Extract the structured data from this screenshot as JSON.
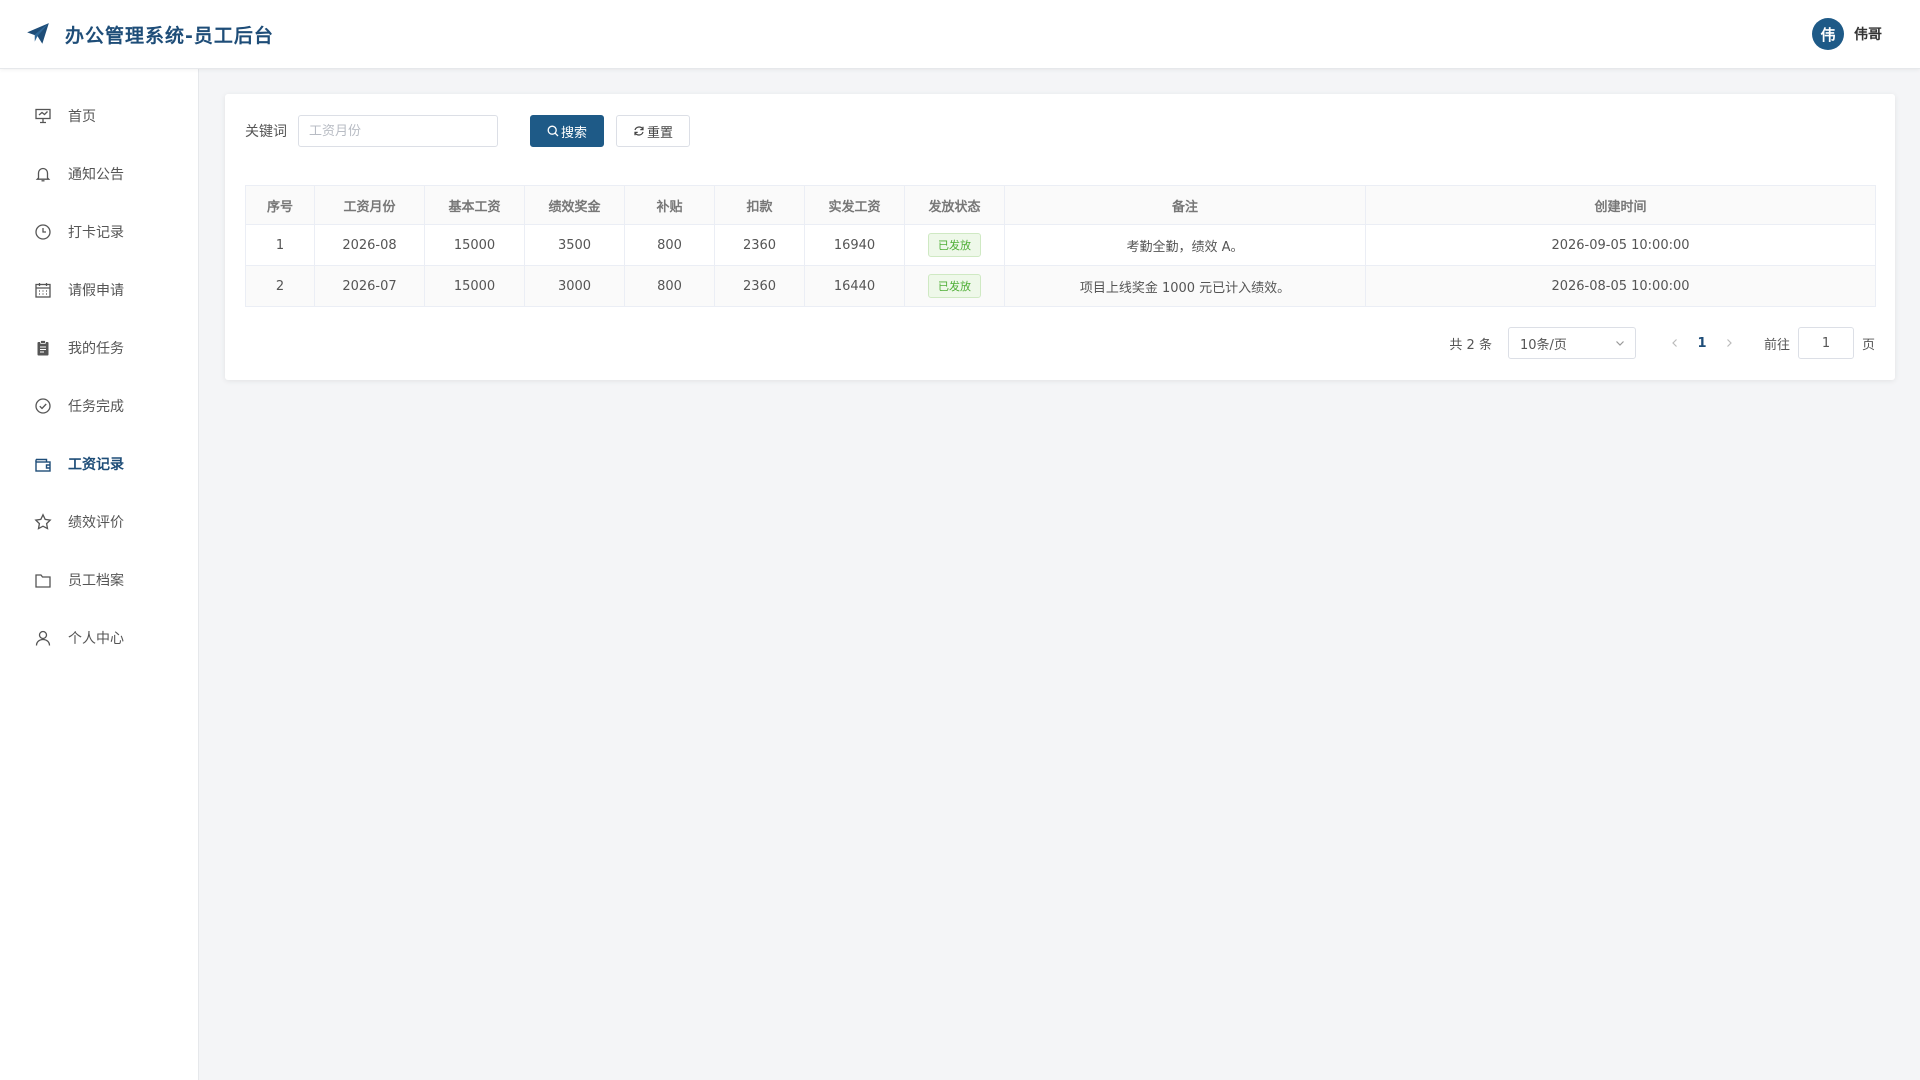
{
  "header": {
    "title": "办公管理系统-员工后台",
    "logo_icon": "paper-plane-icon",
    "user": {
      "avatar_text": "伟",
      "name": "伟哥"
    }
  },
  "colors": {
    "brand": "#1e4d78",
    "primary_button": "#1e5a87",
    "success_text": "#4fae36",
    "background": "#f4f5f7"
  },
  "sidebar": {
    "active": "工资记录",
    "items": [
      {
        "label": "首页",
        "icon": "dashboard-icon"
      },
      {
        "label": "通知公告",
        "icon": "bell-icon"
      },
      {
        "label": "打卡记录",
        "icon": "clock-icon"
      },
      {
        "label": "请假申请",
        "icon": "calendar-icon"
      },
      {
        "label": "我的任务",
        "icon": "clipboard-icon"
      },
      {
        "label": "任务完成",
        "icon": "check-circle-icon"
      },
      {
        "label": "工资记录",
        "icon": "wallet-icon"
      },
      {
        "label": "绩效评价",
        "icon": "star-icon"
      },
      {
        "label": "员工档案",
        "icon": "folder-icon"
      },
      {
        "label": "个人中心",
        "icon": "user-icon"
      }
    ]
  },
  "search": {
    "label": "关键词",
    "placeholder": "工资月份",
    "value": "",
    "search_button": "搜索",
    "reset_button": "重置"
  },
  "table": {
    "columns": [
      "序号",
      "工资月份",
      "基本工资",
      "绩效奖金",
      "补贴",
      "扣款",
      "实发工资",
      "发放状态",
      "备注",
      "创建时间"
    ],
    "rows": [
      [
        "1",
        "2026-08",
        "15000",
        "3500",
        "800",
        "2360",
        "16940",
        "已发放",
        "考勤全勤，绩效 A。",
        "2026-09-05 10:00:00"
      ],
      [
        "2",
        "2026-07",
        "15000",
        "3000",
        "800",
        "2360",
        "16440",
        "已发放",
        "项目上线奖金 1000 元已计入绩效。",
        "2026-08-05 10:00:00"
      ]
    ]
  },
  "pagination": {
    "total_text": "共 2 条",
    "page_size": "10条/页",
    "current_page": "1",
    "goto_label": "前往",
    "goto_value": "1",
    "page_label": "页"
  }
}
